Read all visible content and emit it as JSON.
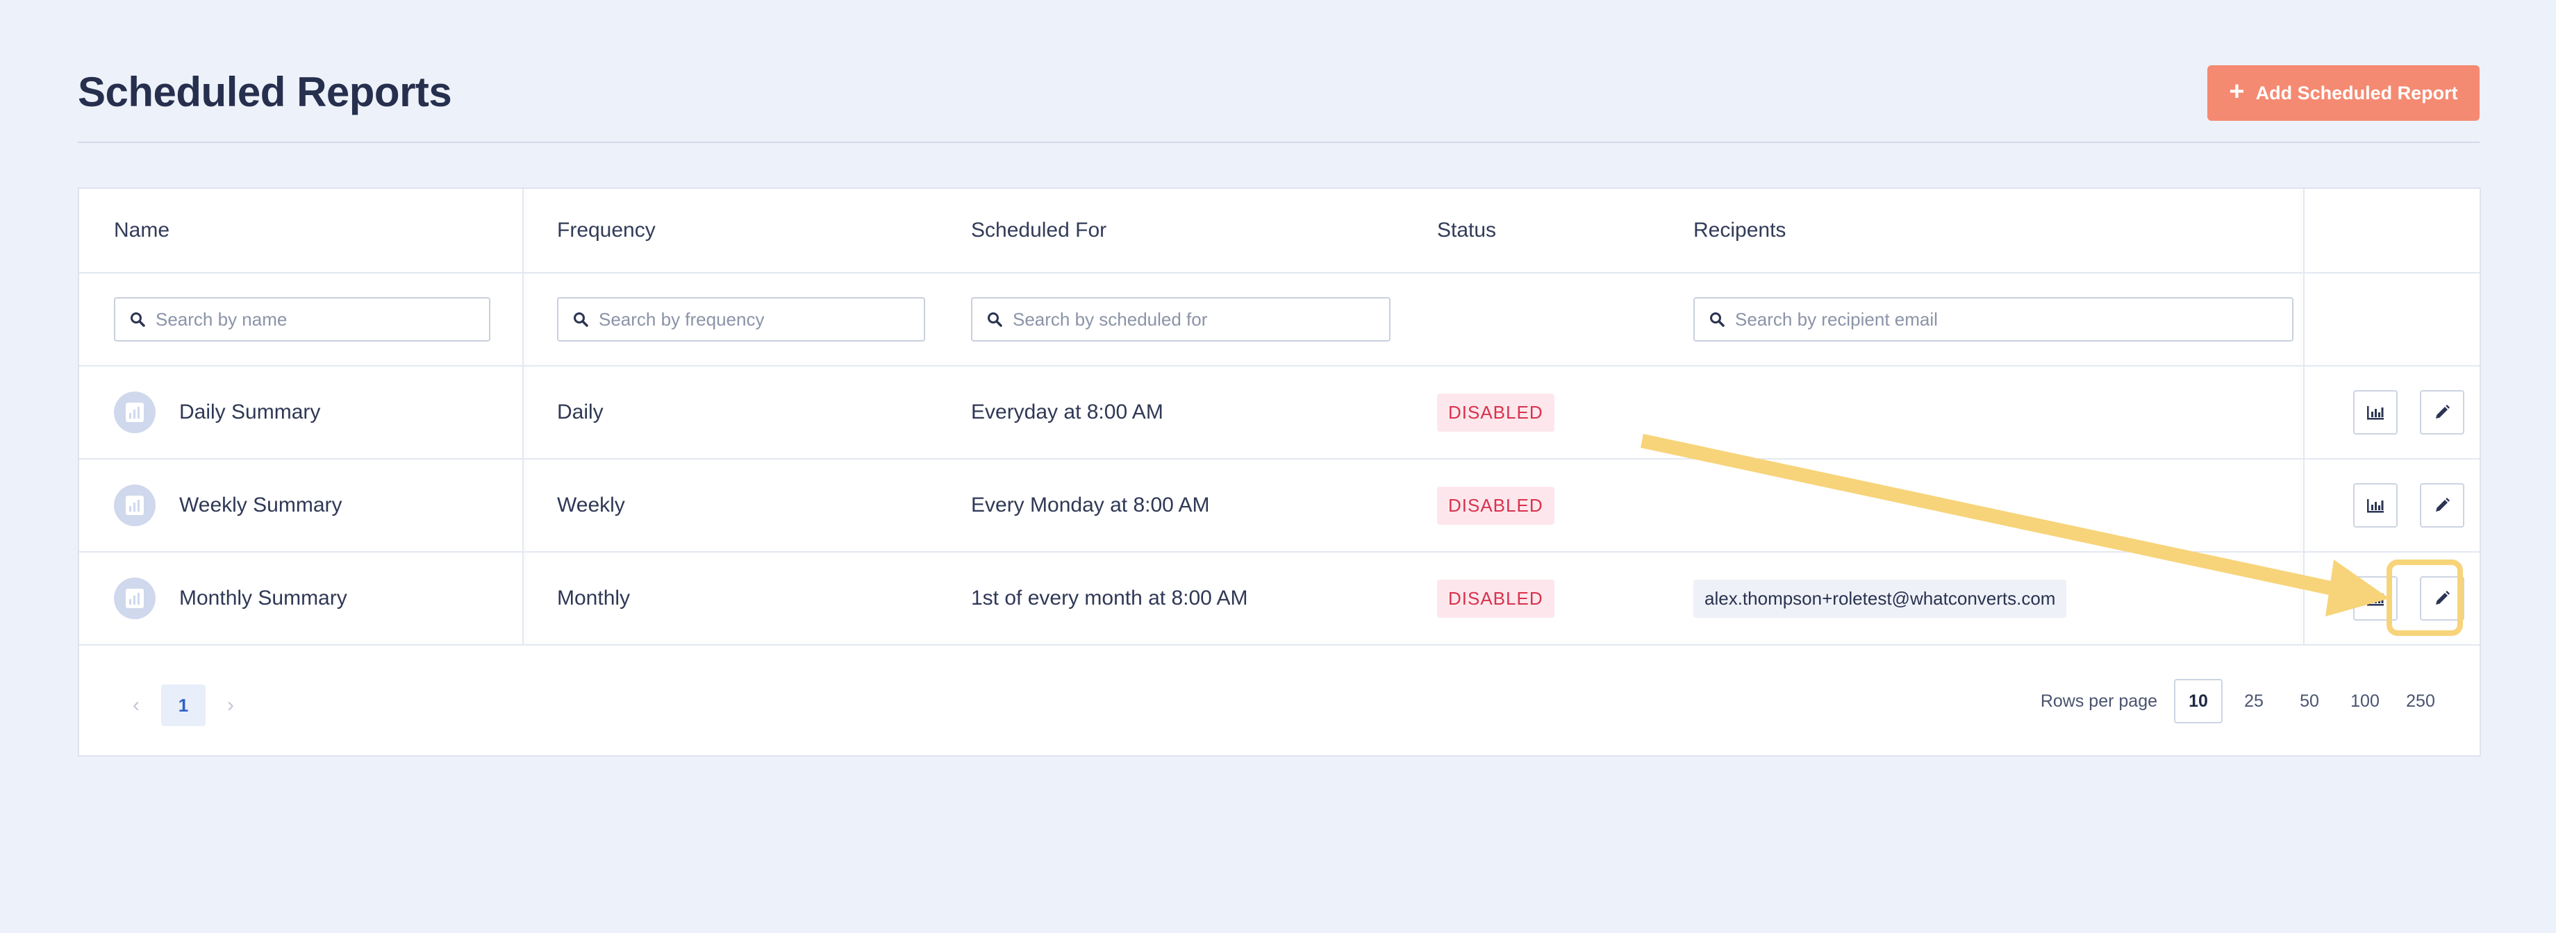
{
  "header": {
    "title": "Scheduled Reports",
    "add_button": "Add Scheduled Report"
  },
  "table": {
    "columns": {
      "name": "Name",
      "frequency": "Frequency",
      "scheduled_for": "Scheduled For",
      "status": "Status",
      "recipients": "Recipents"
    },
    "filters": {
      "name": "Search by name",
      "frequency": "Search by frequency",
      "scheduled_for": "Search by scheduled for",
      "recipients": "Search by recipient email"
    },
    "rows": [
      {
        "name": "Daily Summary",
        "frequency": "Daily",
        "scheduled_for": "Everyday at 8:00 AM",
        "status": "DISABLED",
        "recipient": ""
      },
      {
        "name": "Weekly Summary",
        "frequency": "Weekly",
        "scheduled_for": "Every Monday at 8:00 AM",
        "status": "DISABLED",
        "recipient": ""
      },
      {
        "name": "Monthly Summary",
        "frequency": "Monthly",
        "scheduled_for": "1st of every month at 8:00 AM",
        "status": "DISABLED",
        "recipient": "alex.thompson+roletest@whatconverts.com"
      }
    ]
  },
  "pagination": {
    "prev": "‹",
    "next": "›",
    "current_page": "1",
    "rows_per_page_label": "Rows per page",
    "options": [
      "10",
      "25",
      "50",
      "100",
      "250"
    ],
    "selected": "10"
  },
  "colors": {
    "accent": "#f58a72",
    "status_disabled": "#d8324e",
    "highlight": "#f7d47a"
  }
}
